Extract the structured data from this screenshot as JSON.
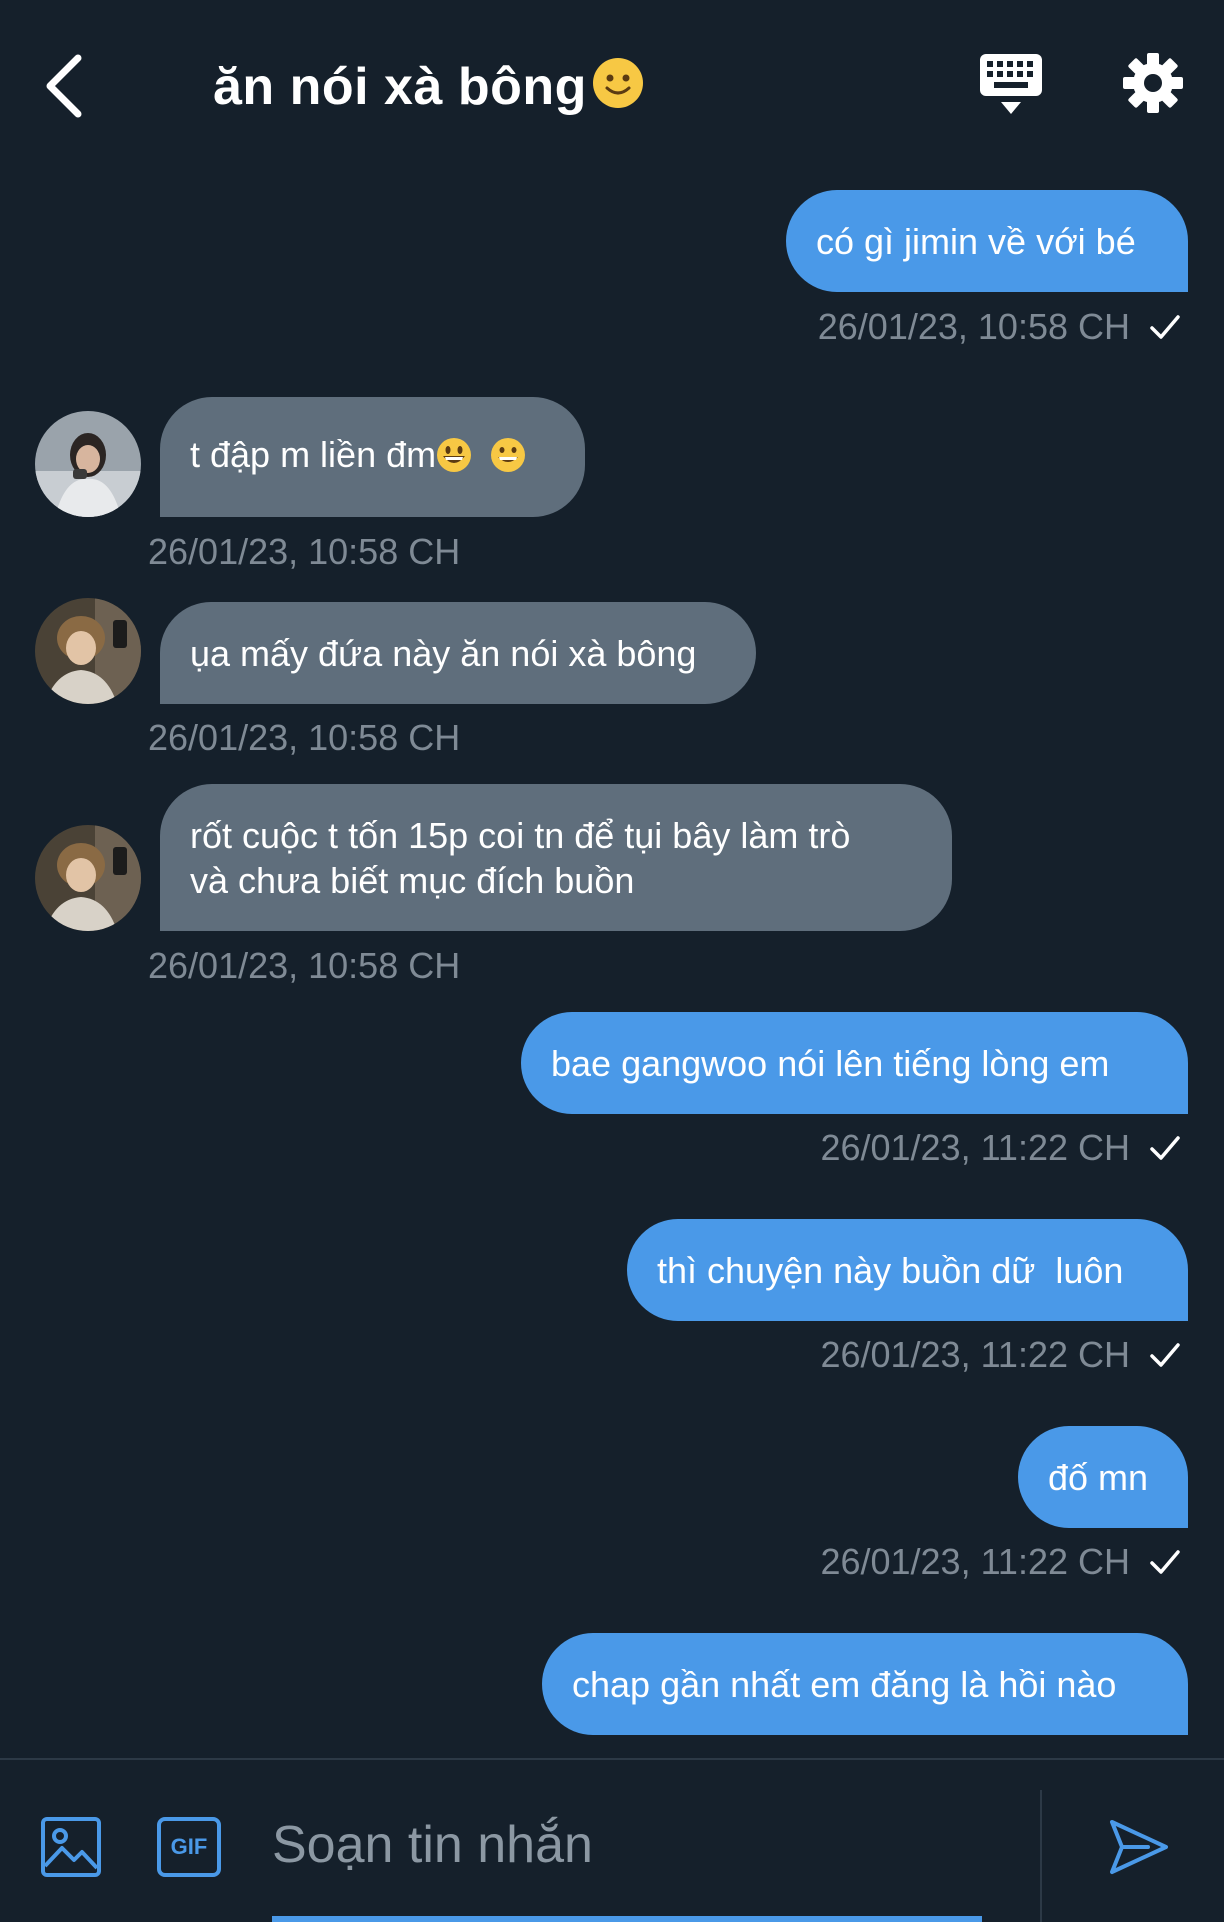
{
  "header": {
    "title": "ăn nói xà bông",
    "back_icon": "chevron-left-icon",
    "keyboard_icon": "keyboard-icon",
    "settings_icon": "gear-icon"
  },
  "messages": [
    {
      "side": "sent",
      "text": "có gì jimin về với bé",
      "time": "26/01/23, 10:58 CH"
    },
    {
      "side": "received",
      "text": "t đập m liền đm",
      "time": "26/01/23, 10:58 CH"
    },
    {
      "side": "received",
      "text": "ụa mấy đứa này ăn nói xà bông",
      "time": "26/01/23, 10:58 CH"
    },
    {
      "side": "received",
      "text_line1": "rốt cuộc t tốn 15p coi tn để tụi bây làm trò",
      "text_line2": "và chưa biết mục đích buồn",
      "time": "26/01/23, 10:58 CH"
    },
    {
      "side": "sent",
      "text": "bae gangwoo nói lên tiếng lòng em",
      "time": "26/01/23, 11:22 CH"
    },
    {
      "side": "sent",
      "text": "thì chuyện này buồn dữ  luôn",
      "time": "26/01/23, 11:22 CH"
    },
    {
      "side": "sent",
      "text": "đố mn",
      "time": "26/01/23, 11:22 CH"
    },
    {
      "side": "sent",
      "text": "chap gần nhất em đăng là hồi nào",
      "time": ""
    }
  ],
  "composer": {
    "placeholder": "Soạn tin nhắn",
    "gif_label": "GIF"
  },
  "colors": {
    "background": "#15202b",
    "sent_bubble": "#4a99e8",
    "received_bubble": "#5f6e7c",
    "timestamp": "#7f8a95"
  }
}
